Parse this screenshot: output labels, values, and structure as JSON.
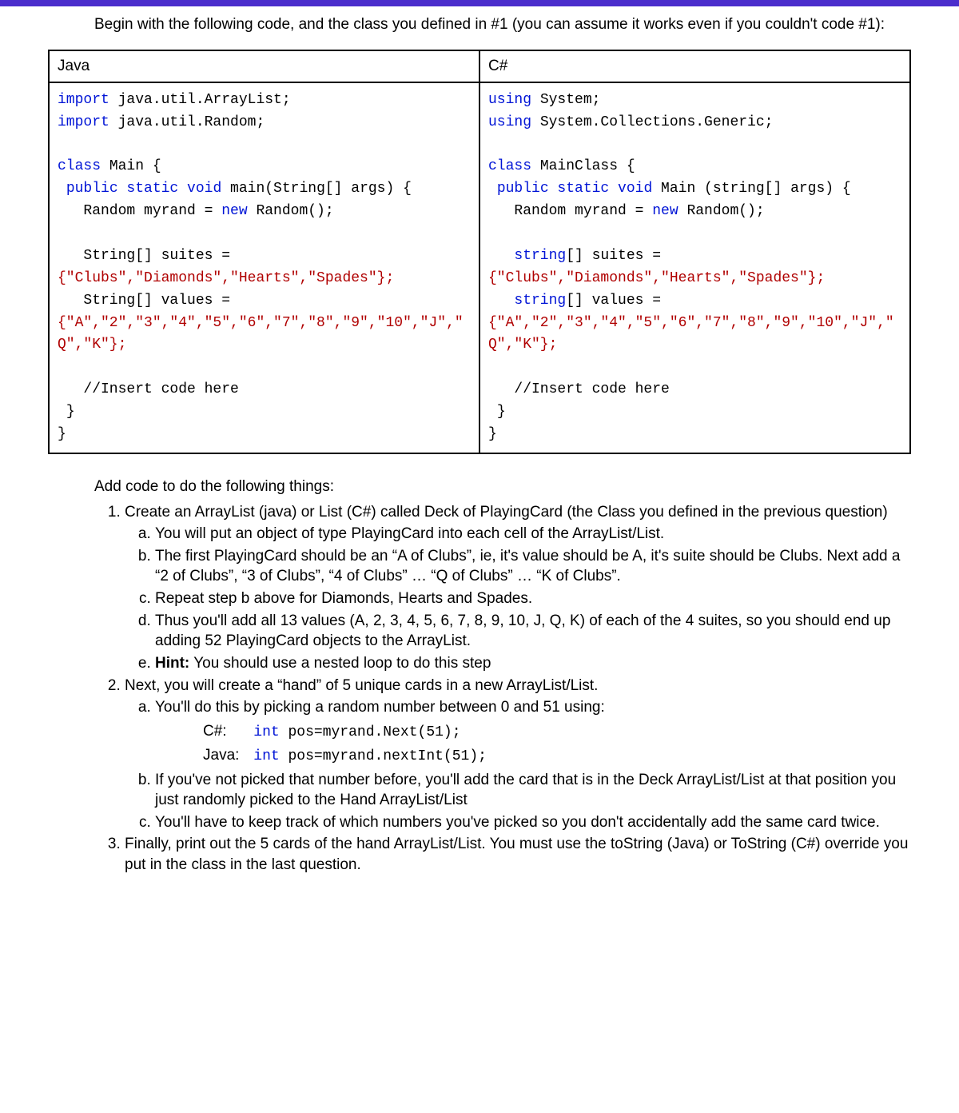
{
  "intro": "Begin with the following code, and the class you defined in #1 (you can assume it works even if you couldn't code #1):",
  "table": {
    "headers": {
      "java": "Java",
      "csharp": "C#"
    },
    "java": {
      "line1": "import",
      "line1b": " java.util.ArrayList;",
      "line2": "import",
      "line2b": " java.util.Random;",
      "line3a": "class",
      "line3b": " Main {",
      "line4a": " public static void",
      "line4b": " main(String[] args) {",
      "line5a": "   Random myrand = ",
      "line5b": "new",
      "line5c": " Random();",
      "line6": "   String[] suites =",
      "line7": "{\"Clubs\",\"Diamonds\",\"Hearts\",\"Spades\"};",
      "line8": "   String[] values =",
      "line9": "{\"A\",\"2\",\"3\",\"4\",\"5\",\"6\",\"7\",\"8\",\"9\",\"10\",\"J\",\"Q\",\"K\"};",
      "line10": "   //Insert code here",
      "line11": " }",
      "line12": "}"
    },
    "csharp": {
      "line1": "using",
      "line1b": " System;",
      "line2": "using",
      "line2b": " System.Collections.Generic;",
      "line3a": "class",
      "line3b": " MainClass {",
      "line4a": " public static void",
      "line4b": " Main (string[] args) {",
      "line5a": "   Random myrand = ",
      "line5b": "new",
      "line5c": " Random();",
      "line6a": "   string",
      "line6b": "[] suites =",
      "line7": "{\"Clubs\",\"Diamonds\",\"Hearts\",\"Spades\"};",
      "line8a": "   string",
      "line8b": "[] values =",
      "line9": "{\"A\",\"2\",\"3\",\"4\",\"5\",\"6\",\"7\",\"8\",\"9\",\"10\",\"J\",\"Q\",\"K\"};",
      "line10": "   //Insert code here",
      "line11": " }",
      "line12": "}"
    }
  },
  "instr": {
    "lead": "Add code to do the following things:",
    "i1": "Create an ArrayList (java) or List (C#) called Deck of PlayingCard (the Class you defined in the previous question)",
    "i1a": "You will put an object of type PlayingCard into each cell of the ArrayList/List.",
    "i1b": "The first PlayingCard should be an “A of Clubs”, ie, it's value should be A, it's suite should be Clubs.  Next add a “2 of Clubs”, “3 of Clubs”, “4 of Clubs” … “Q of Clubs” … “K of Clubs”.",
    "i1c": "Repeat step b above for Diamonds, Hearts and Spades.",
    "i1d": "Thus you'll add all 13 values (A, 2, 3, 4, 5, 6, 7, 8, 9, 10, J, Q, K) of each of the 4 suites, so you should end up adding 52 PlayingCard objects to the ArrayList.",
    "i1e_pre": "Hint:",
    "i1e": "  You should use a nested loop to do this step",
    "i2": "Next, you will create a “hand” of 5 unique cards in a new ArrayList/List.",
    "i2a": "You'll do this by picking a random number between 0 and 51 using:",
    "i2a_cs_lbl": "C#:",
    "i2a_cs_code_a": "int",
    "i2a_cs_code_b": " pos=myrand.Next(51);",
    "i2a_jv_lbl": "Java:",
    "i2a_jv_code_a": "int",
    "i2a_jv_code_b": " pos=myrand.nextInt(51);",
    "i2b": "If you've not picked that number before, you'll add the card that is in the Deck ArrayList/List at that position you just randomly picked to the Hand ArrayList/List",
    "i2c": "You'll have to keep track of which numbers you've picked so you don't accidentally add the same card twice.",
    "i3": "Finally, print out the 5 cards of the hand ArrayList/List.  You must use the toString (Java) or ToString (C#) override you put in the class in the last question."
  }
}
